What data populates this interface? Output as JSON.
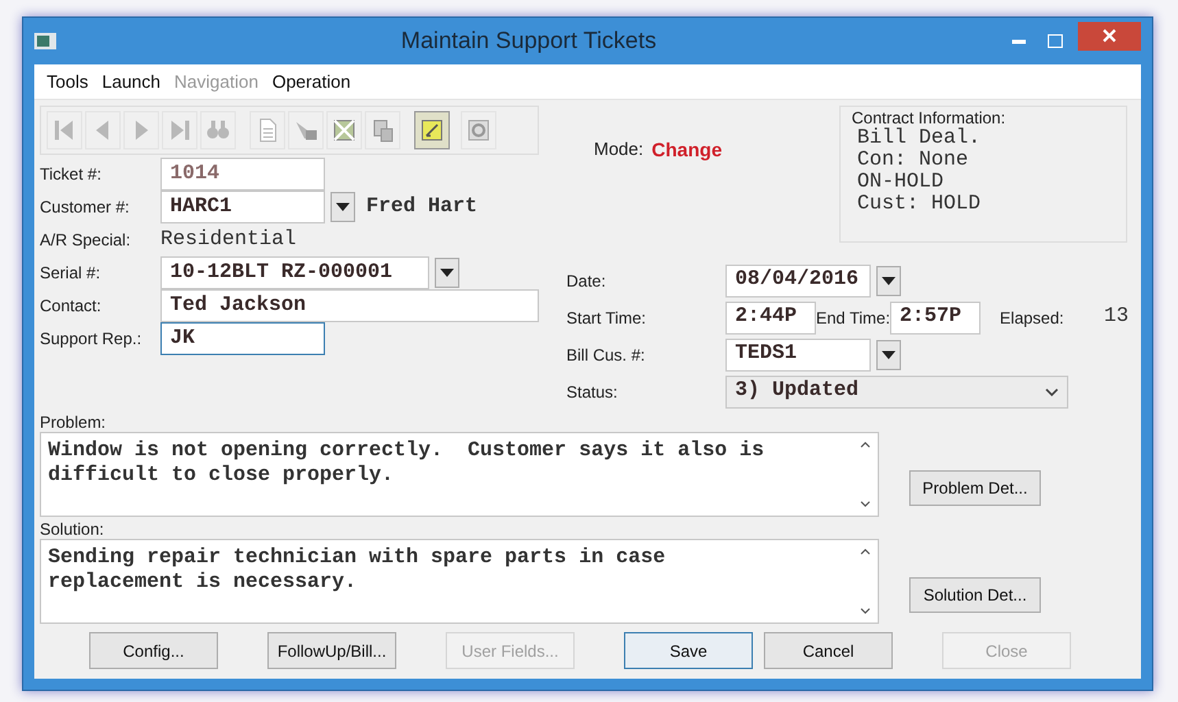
{
  "window": {
    "title": "Maintain Support Tickets"
  },
  "menu": [
    {
      "label": "Tools",
      "disabled": false
    },
    {
      "label": "Launch",
      "disabled": false
    },
    {
      "label": "Navigation",
      "disabled": true
    },
    {
      "label": "Operation",
      "disabled": false
    }
  ],
  "mode": {
    "label": "Mode:",
    "value": "Change"
  },
  "contract": {
    "title": "Contract Information:",
    "lines": [
      "Bill Deal.",
      "Con: None",
      "ON-HOLD",
      "Cust: HOLD"
    ]
  },
  "left_fields": [
    {
      "kind": "field",
      "label": "Ticket #:",
      "value": "1014",
      "readonly": true
    },
    {
      "kind": "lookup",
      "label": "Customer #:",
      "value": "HARC1",
      "note": "Fred Hart"
    },
    {
      "kind": "text",
      "label": "A/R Special:",
      "value": "Residential"
    },
    {
      "kind": "lookup",
      "label": "Serial #:",
      "value": "10-12BLT RZ-000001",
      "wide": true
    },
    {
      "kind": "field",
      "label": "Contact:",
      "value": "Ted Jackson",
      "wide": true
    },
    {
      "kind": "field",
      "label": "Support Rep.:",
      "value": "JK",
      "focused": true
    }
  ],
  "right_fields": [
    {
      "kind": "date",
      "label": "Date:",
      "value": "08/04/2016"
    },
    {
      "kind": "times",
      "label": "Start Time:",
      "value": "2:44P",
      "end_label": "End Time:",
      "end_value": "2:57P",
      "elapsed_label": "Elapsed:",
      "elapsed_value": "13"
    },
    {
      "kind": "lookup",
      "label": "Bill Cus. #:",
      "value": "TEDS1"
    },
    {
      "kind": "select",
      "label": "Status:",
      "value": "3) Updated"
    }
  ],
  "memos": [
    {
      "label": "Problem:",
      "text": "Window is not opening correctly.  Customer says it also is difficult to close properly.",
      "button": "Problem Det..."
    },
    {
      "label": "Solution:",
      "text": "Sending repair technician with spare parts in case replacement is necessary.",
      "button": "Solution Det..."
    }
  ],
  "buttons": [
    {
      "label": "Config...",
      "disabled": false,
      "default": false
    },
    {
      "label": "FollowUp/Bill...",
      "disabled": false,
      "default": false
    },
    {
      "label": "User Fields...",
      "disabled": true,
      "default": false
    },
    {
      "label": "Save",
      "disabled": false,
      "default": true
    },
    {
      "label": "Cancel",
      "disabled": false,
      "default": false
    },
    {
      "label": "Close",
      "disabled": true,
      "default": false
    }
  ]
}
